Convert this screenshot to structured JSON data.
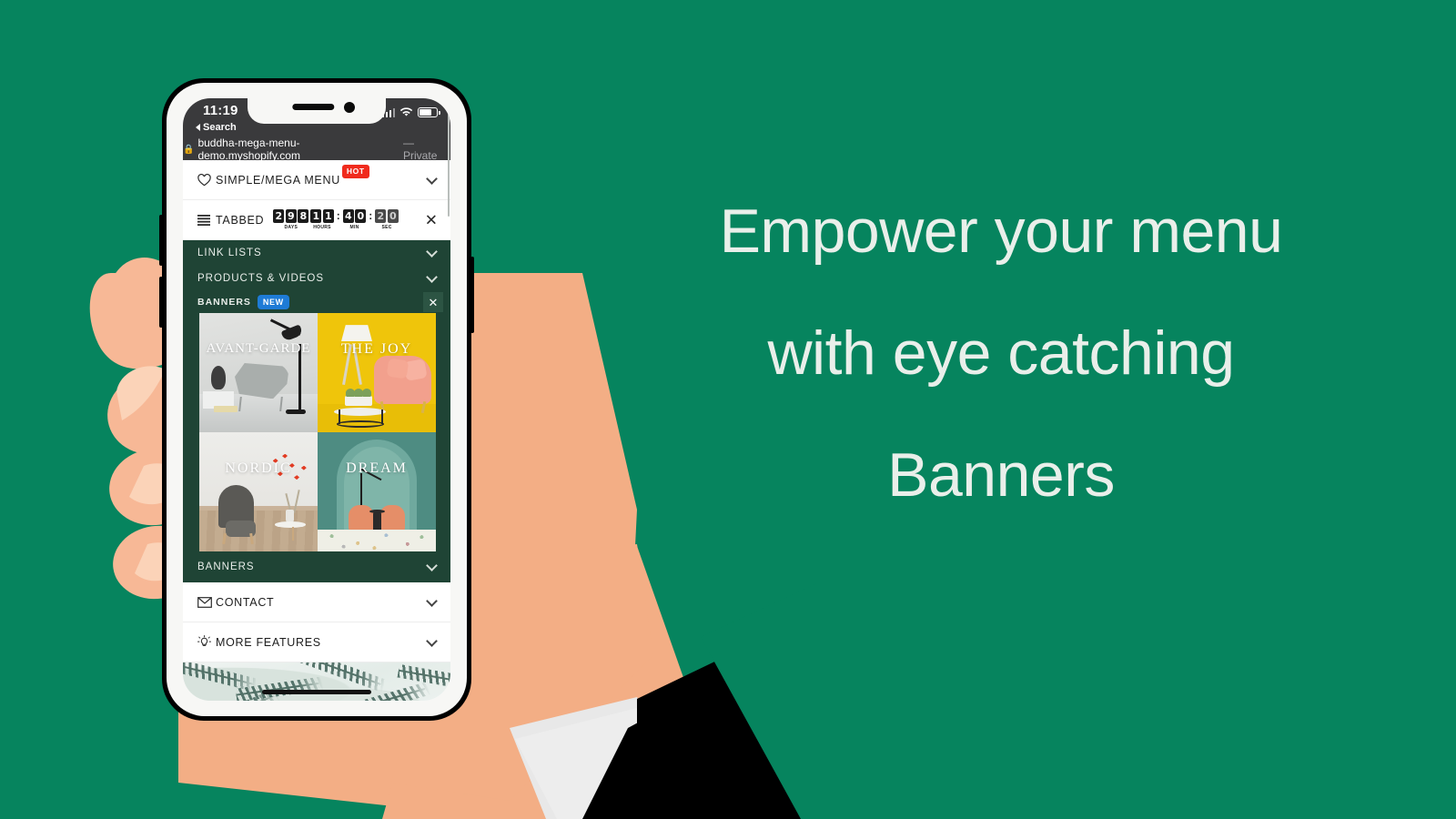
{
  "page": {
    "background_color": "#06845E",
    "headline_color": "#E9EFEA"
  },
  "headline": {
    "line1": "Empower your menu",
    "line2": "with eye catching",
    "line3": "Banners"
  },
  "phone": {
    "status_bar": {
      "time": "11:19",
      "signal_icon": "cellular-bars-icon",
      "wifi_icon": "wifi-icon",
      "battery_icon": "battery-icon"
    },
    "safari": {
      "back_label": "Search",
      "back_icon": "back-triangle-icon",
      "lock_icon": "lock-icon",
      "url": "buddha-mega-menu-demo.myshopify.com",
      "private_label": "— Private"
    }
  },
  "menu": {
    "white_rows": [
      {
        "label": "SIMPLE/MEGA MENU",
        "icon": "heart-icon",
        "badge": "HOT",
        "badge_color": "#F02B1D",
        "control": "chevron-down-icon"
      },
      {
        "label": "TABBED",
        "icon": "hamburger-lines-icon",
        "control": "close-icon"
      }
    ],
    "countdown": {
      "days": {
        "digits": [
          "2",
          "9",
          "8"
        ],
        "label": "DAYS"
      },
      "hours": {
        "digits": [
          "1",
          "1"
        ],
        "label": "HOURS"
      },
      "minutes": {
        "digits": [
          "4",
          "0"
        ],
        "label": "MIN"
      },
      "seconds": {
        "digits": [
          "2",
          "0"
        ],
        "label": "SEC",
        "flipping": true
      },
      "separator": ":"
    },
    "green_rows": [
      {
        "label": "LINK LISTS",
        "control": "chevron-down-icon"
      },
      {
        "label": "PRODUCTS & VIDEOS",
        "control": "chevron-down-icon"
      }
    ],
    "banners_header": {
      "label": "BANNERS",
      "badge": "NEW",
      "badge_color": "#1E7BD6",
      "control": "close-icon"
    },
    "banners_footer": {
      "label": "BANNERS",
      "control": "chevron-down-icon"
    },
    "bottom_rows": [
      {
        "label": "CONTACT",
        "icon": "envelope-icon",
        "control": "chevron-down-icon"
      },
      {
        "label": "MORE FEATURES",
        "icon": "lightbulb-icon",
        "control": "chevron-down-icon"
      }
    ],
    "panel_color": "#1F4435"
  },
  "banners": [
    {
      "caption": "AVANT-GARDE",
      "theme": "light-grey-living-room"
    },
    {
      "caption": "THE JOY",
      "theme": "yellow-room-pink-sofa"
    },
    {
      "caption": "NORDIC",
      "theme": "nordic-grey-armchair"
    },
    {
      "caption": "DREAM",
      "theme": "teal-arch-orange-chairs"
    }
  ]
}
